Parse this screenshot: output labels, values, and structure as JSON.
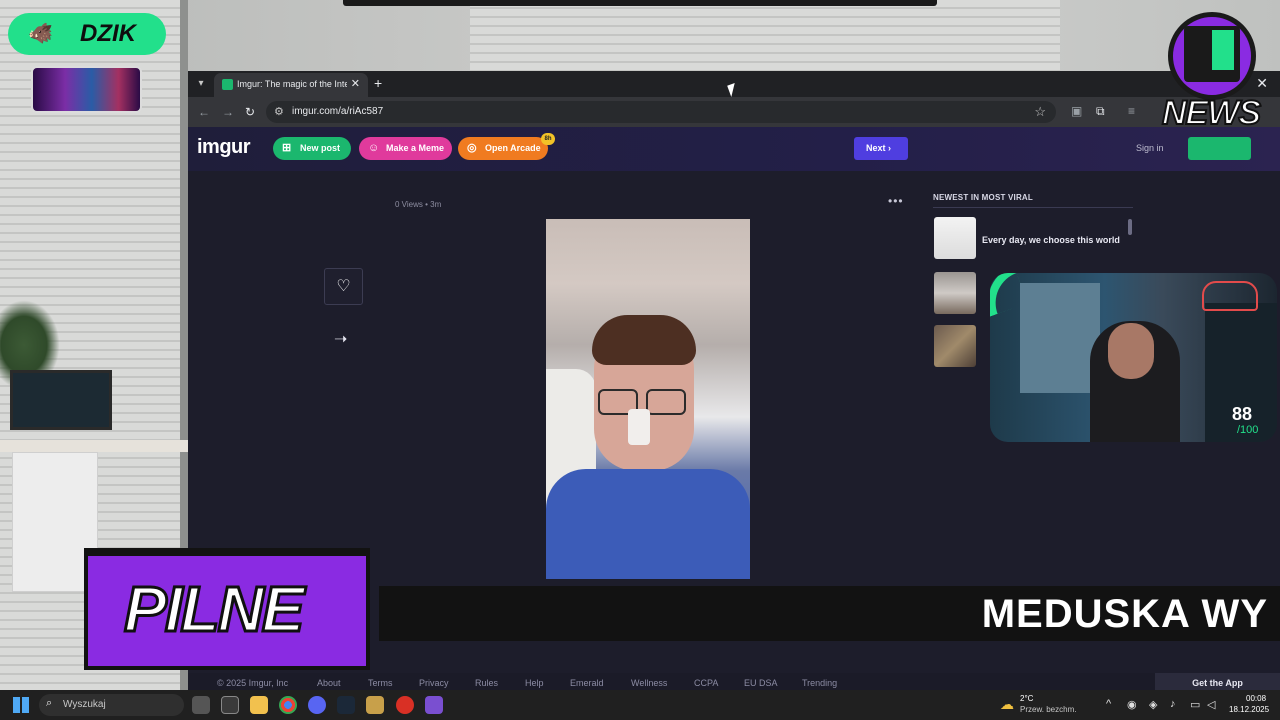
{
  "overlay": {
    "channel_label": "DZIK",
    "news_label": "NEWS",
    "breaking_label": "PILNE",
    "ticker_text": "MEDUSKA WY",
    "score_value": "88",
    "score_max": "/100"
  },
  "browser": {
    "tab_title": "Imgur: The magic of the Interne",
    "url": "imgur.com/a/riAc587"
  },
  "imgur": {
    "logo": "imgur",
    "new_post_label": "New post",
    "meme_label": "Make a Meme",
    "arcade_label": "Open Arcade",
    "arcade_badge": "8h",
    "next_label": "Next",
    "sign_in_label": "Sign in",
    "post_meta": "0 Views • 3m",
    "newest_heading": "NEWEST IN MOST VIRAL",
    "viral_items": [
      {
        "title": "Every day, we choose this world"
      }
    ],
    "footer_links": [
      "© 2025 Imgur, Inc",
      "About",
      "Terms",
      "Privacy",
      "Rules",
      "Help",
      "Emerald",
      "Wellness",
      "CCPA",
      "EU DSA",
      "Trending"
    ],
    "get_app_label": "Get the App"
  },
  "taskbar": {
    "search_placeholder": "Wyszukaj",
    "weather_temp": "2°C",
    "weather_desc": "Przew. bezchm.",
    "time": "00:08",
    "date": "18.12.2025"
  },
  "icons": {
    "heart": "heart-icon",
    "share": "arrow-right-icon",
    "bookmark": "star-icon"
  },
  "colors": {
    "imgur_green": "#1bb76e",
    "imgur_next": "#4f3ee0",
    "meme_pink": "#e03a9c",
    "arcade_orange": "#f07b20",
    "overlay_purple": "#8a2be2",
    "overlay_green": "#22e08b"
  }
}
